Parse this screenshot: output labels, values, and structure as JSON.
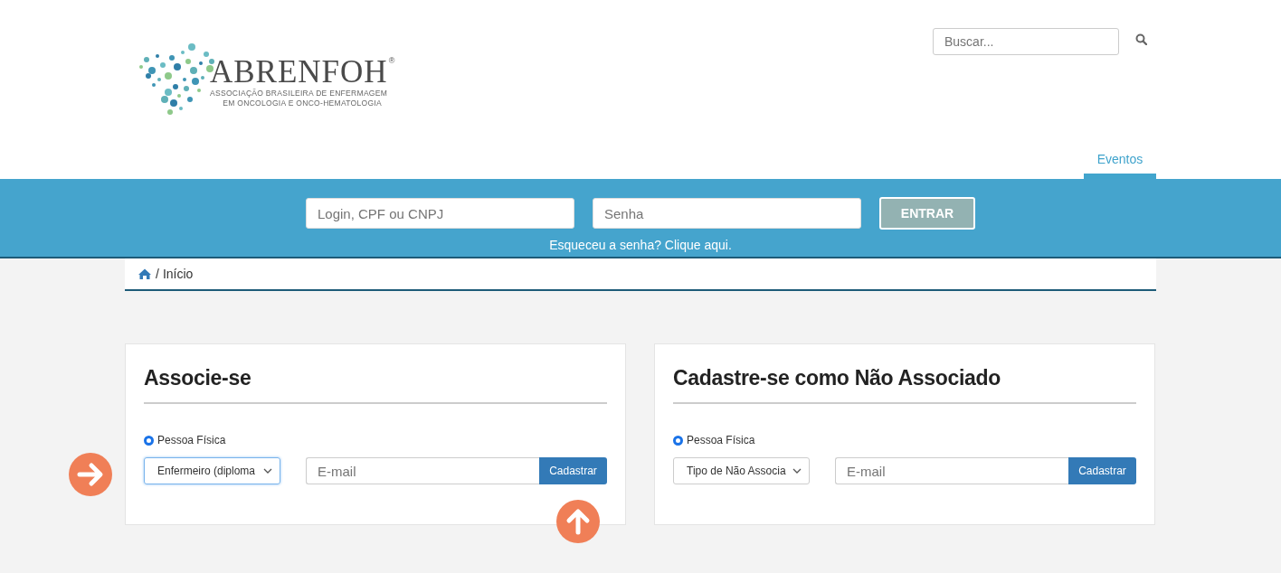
{
  "header": {
    "logo": {
      "name": "ABRENFOH",
      "registered": "®",
      "line_1": "ASSOCIAÇÃO BRASILEIRA DE ENFERMAGEM",
      "line_2": "EM ONCOLOGIA E ONCO-HEMATOLOGIA"
    },
    "search": {
      "placeholder": "Buscar..."
    },
    "nav": [
      {
        "label": "Eventos",
        "selected": true
      }
    ]
  },
  "login": {
    "user_placeholder": "Login, CPF ou CNPJ",
    "password_placeholder": "Senha",
    "button": "ENTRAR",
    "forgot_link": "Esqueceu a senha? Clique aqui."
  },
  "breadcrumb": {
    "separator": "/",
    "current": "Início"
  },
  "cards": [
    {
      "title": "Associe-se",
      "radio": {
        "label": "Pessoa Física",
        "checked": true
      },
      "select": {
        "value": "Enfermeiro (diploma",
        "focused": true
      },
      "email_placeholder": "E-mail",
      "button": "Cadastrar",
      "markers": [
        {
          "kind": "arrow-right"
        },
        {
          "kind": "arrow-up"
        }
      ]
    },
    {
      "title": "Cadastre-se como Não Associado",
      "radio": {
        "label": "Pessoa Física",
        "checked": true
      },
      "select": {
        "value": "Tipo de Não Associa",
        "focused": false
      },
      "email_placeholder": "E-mail",
      "button": "Cadastrar"
    }
  ]
}
